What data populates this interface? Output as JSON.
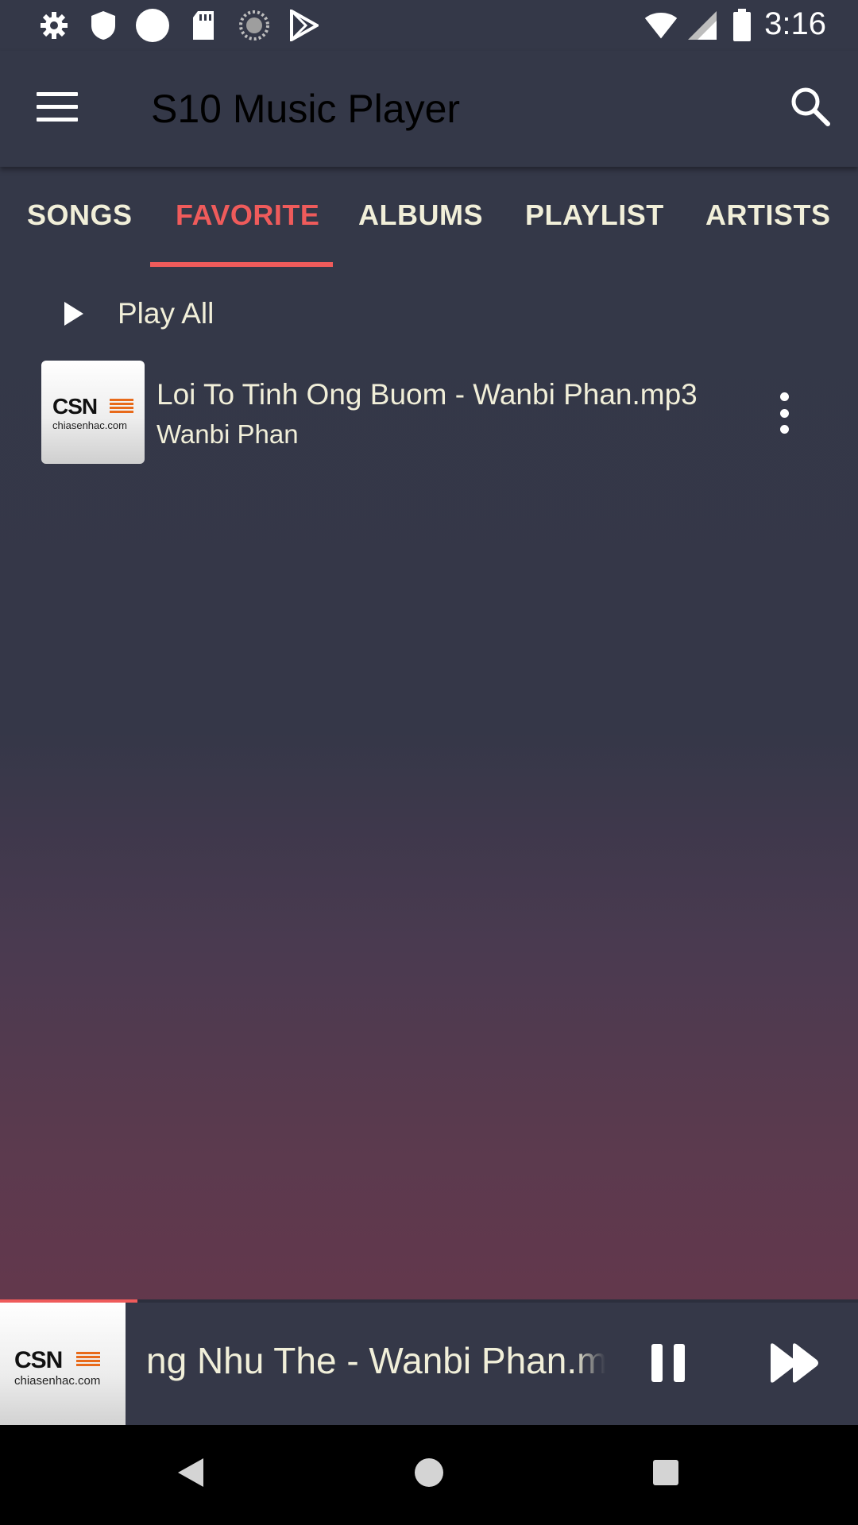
{
  "status_bar": {
    "time": "3:16",
    "left_icons": [
      "gear-icon",
      "shield-icon",
      "circle-icon",
      "sd-card-icon",
      "loading-icon",
      "play-store-icon"
    ],
    "right_icons": [
      "wifi-icon",
      "cell-signal-icon",
      "battery-icon"
    ]
  },
  "app_bar": {
    "title": "S10 Music Player",
    "menu_icon": "hamburger-menu-icon",
    "search_icon": "search-icon",
    "title_color": "#000000"
  },
  "tabs": [
    {
      "label": "SONGS",
      "active": false
    },
    {
      "label": "FAVORITE",
      "active": true
    },
    {
      "label": "ALBUMS",
      "active": false
    },
    {
      "label": "PLAYLIST",
      "active": false
    },
    {
      "label": "ARTISTS",
      "active": false
    }
  ],
  "colors": {
    "accent": "#ef5b5b",
    "text": "#f1efd9",
    "background_top": "#343848",
    "background_bottom": "#6e344a"
  },
  "play_all": {
    "label": "Play All",
    "icon": "play-icon"
  },
  "songs": [
    {
      "title": "Loi To Tinh Ong Buom - Wanbi Phan.mp3",
      "artist": "Wanbi Phan",
      "art_logo": "CSN",
      "art_site": "chiasenhac.com",
      "menu_icon": "more-vert-icon"
    }
  ],
  "now_playing": {
    "title_visible": "ng Nhu The - Wanbi Phan.mp",
    "art_logo": "CSN",
    "art_site": "chiasenhac.com",
    "progress": 0.16,
    "pause_icon": "pause-icon",
    "next_icon": "fast-forward-icon"
  },
  "nav_bar": {
    "back_icon": "back-icon",
    "home_icon": "home-icon",
    "recents_icon": "recents-icon"
  }
}
